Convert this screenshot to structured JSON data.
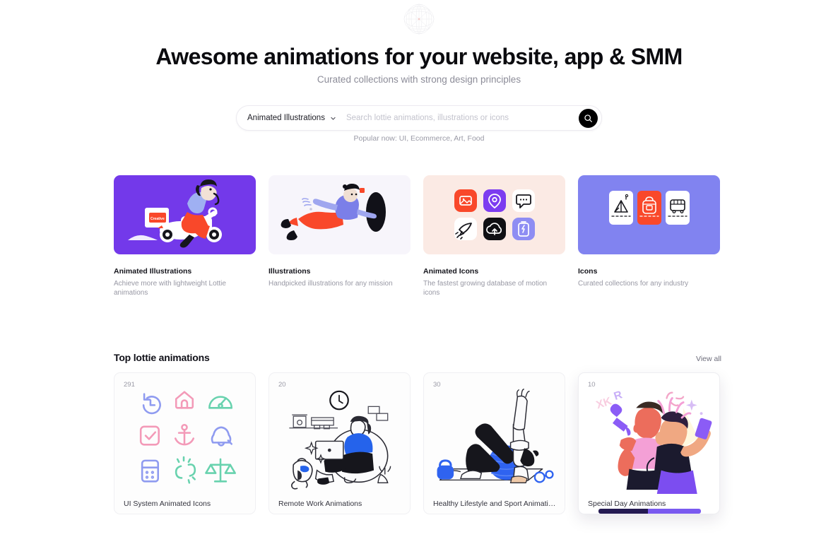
{
  "brand": {
    "logo_icon": "wireframe-globe-logo"
  },
  "hero": {
    "title": "Awesome animations for your website, app & SMM",
    "subtitle": "Curated collections with strong design principles"
  },
  "search": {
    "category_label": "Animated Illustrations",
    "chevron_icon": "chevron-down-icon",
    "placeholder": "Search lottie animations, illustrations or icons",
    "value": "",
    "submit_icon": "search-icon",
    "popular_text": "Popular now: UI, Ecommerce, Art, Food"
  },
  "categories": [
    {
      "title": "Animated Illustrations",
      "desc": "Achieve more with lightweight Lottie animations",
      "bg": "#7339ea",
      "art": "scooter-delivery-illustration"
    },
    {
      "title": "Illustrations",
      "desc": "Handpicked illustrations for any mission",
      "bg": "#f7f5fb",
      "art": "flying-person-illustration"
    },
    {
      "title": "Animated Icons",
      "desc": "The fastest growing database of motion icons",
      "bg": "#fbeae4",
      "art": "animated-icon-tiles",
      "tiles": [
        {
          "icon": "image-icon",
          "bg": "#f9482a",
          "fg": "#ffffff"
        },
        {
          "icon": "location-pin-icon",
          "bg": "#7c3cf0",
          "fg": "#ffffff"
        },
        {
          "icon": "chat-bubble-icon",
          "bg": "#ffffff",
          "fg": "#16161c"
        },
        {
          "icon": "rocket-icon",
          "bg": "#ffffff",
          "fg": "#16161c"
        },
        {
          "icon": "cloud-upload-icon",
          "bg": "#101014",
          "fg": "#ffffff"
        },
        {
          "icon": "battery-charge-icon",
          "bg": "#8e8df3",
          "fg": "#ffffff"
        }
      ]
    },
    {
      "title": "Icons",
      "desc": "Curated collections for any industry",
      "bg": "#8183f0",
      "art": "industry-icon-cards",
      "tiles": [
        {
          "icon": "camping-tent-icon",
          "bg": "#ffffff",
          "fg": "#16161c"
        },
        {
          "icon": "backpack-icon",
          "bg": "#f9482a",
          "fg": "#ffffff"
        },
        {
          "icon": "bus-icon",
          "bg": "#ffffff",
          "fg": "#16161c"
        }
      ]
    }
  ],
  "top_section": {
    "title": "Top lottie animations",
    "view_all": "View all",
    "items": [
      {
        "count": "291",
        "name": "UI System Animated Icons",
        "art": "pastel-ui-icon-grid",
        "icons": [
          {
            "icon": "history-clock-icon",
            "color": "#8f9bf0"
          },
          {
            "icon": "home-icon",
            "color": "#f39ab8"
          },
          {
            "icon": "speedometer-icon",
            "color": "#68d2ae"
          },
          {
            "icon": "checkbox-icon",
            "color": "#f39ab8"
          },
          {
            "icon": "anchor-icon",
            "color": "#f39ab8"
          },
          {
            "icon": "bell-icon",
            "color": "#8f9bf0"
          },
          {
            "icon": "calculator-icon",
            "color": "#8f9bf0"
          },
          {
            "icon": "broken-link-icon",
            "color": "#68d2ae"
          },
          {
            "icon": "scales-icon",
            "color": "#68d2ae"
          }
        ],
        "raised": false
      },
      {
        "count": "20",
        "name": "Remote Work Animations",
        "art": "remote-work-illustration",
        "raised": false
      },
      {
        "count": "30",
        "name": "Healthy Lifestyle and Sport Animations",
        "art": "yoga-fitness-illustration",
        "raised": false
      },
      {
        "count": "10",
        "name": "Special Day Animations",
        "art": "celebration-selfie-illustration",
        "raised": true,
        "progress": {
          "played_pct": 48,
          "played_color": "#241a52",
          "track_color": "#7a5af0"
        }
      }
    ]
  }
}
